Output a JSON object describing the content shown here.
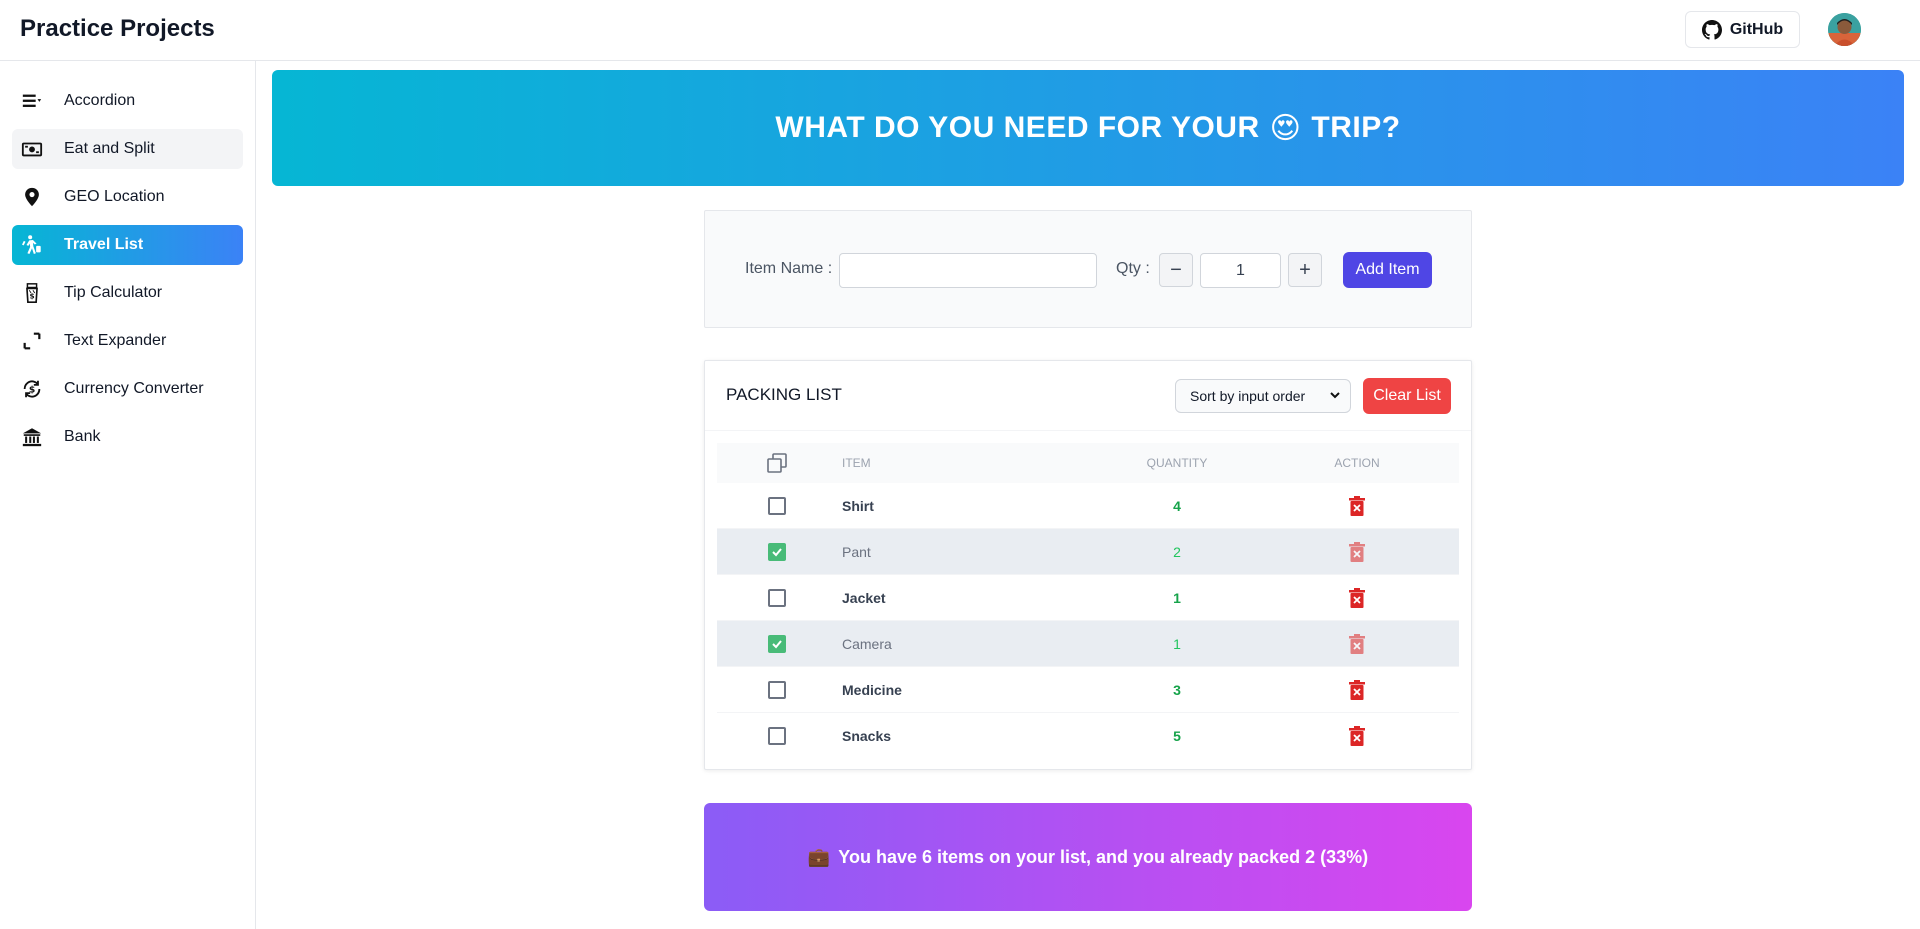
{
  "app": {
    "title": "Practice Projects",
    "github_label": "GitHub"
  },
  "sidebar": {
    "items": [
      {
        "label": "Accordion",
        "icon": "accordion-icon"
      },
      {
        "label": "Eat and Split",
        "icon": "money-icon"
      },
      {
        "label": "GEO Location",
        "icon": "location-pin-icon"
      },
      {
        "label": "Travel List",
        "icon": "walking-luggage-icon"
      },
      {
        "label": "Tip Calculator",
        "icon": "tip-jar-icon"
      },
      {
        "label": "Text Expander",
        "icon": "expand-icon"
      },
      {
        "label": "Currency Converter",
        "icon": "currency-exchange-icon"
      },
      {
        "label": "Bank",
        "icon": "bank-icon"
      }
    ],
    "active": "Travel List",
    "hovered": "Eat and Split"
  },
  "banner": {
    "text_before": "WHAT DO YOU NEED FOR YOUR",
    "emoji": "😍",
    "text_after": "TRIP?"
  },
  "form": {
    "item_label": "Item Name :",
    "item_value": "",
    "qty_label": "Qty :",
    "qty_value": "1",
    "minus": "−",
    "plus": "+",
    "add_label": "Add Item"
  },
  "packing": {
    "title": "PACKING LIST",
    "sort_value": "Sort by input order",
    "clear_label": "Clear List",
    "columns": {
      "item": "ITEM",
      "quantity": "QUANTITY",
      "action": "ACTION"
    },
    "rows": [
      {
        "item": "Shirt",
        "quantity": "4",
        "packed": false
      },
      {
        "item": "Pant",
        "quantity": "2",
        "packed": true
      },
      {
        "item": "Jacket",
        "quantity": "1",
        "packed": false
      },
      {
        "item": "Camera",
        "quantity": "1",
        "packed": true
      },
      {
        "item": "Medicine",
        "quantity": "3",
        "packed": false
      },
      {
        "item": "Snacks",
        "quantity": "5",
        "packed": false
      }
    ]
  },
  "stats": {
    "emoji": "💼",
    "text": "You have 6 items on your list, and you already packed 2 (33%)"
  },
  "colors": {
    "accent_start": "#06b6d4",
    "accent_end": "#3b82f6",
    "add_button": "#4f46e5",
    "clear_button": "#ef4444",
    "stats_start": "#8b5cf6",
    "stats_end": "#d946ef",
    "checked": "#48bb78"
  }
}
